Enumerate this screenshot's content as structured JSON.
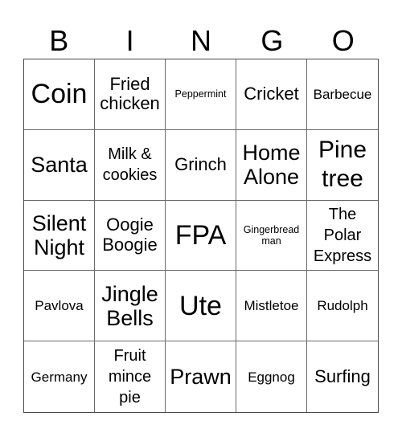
{
  "header": {
    "letters": [
      "B",
      "I",
      "N",
      "G",
      "O"
    ]
  },
  "cells": [
    "Coin",
    "Fried chicken",
    "Peppermint",
    "Cricket",
    "Barbecue",
    "Santa",
    "Milk & cookies",
    "Grinch",
    "Home Alone",
    "Pine tree",
    "Silent Night",
    "Oogie Boogie",
    "FPA",
    "Gingerbread man",
    "The Polar Express",
    "Pavlova",
    "Jingle Bells",
    "Ute",
    "Mistletoe",
    "Rudolph",
    "Germany",
    "Fruit mince pie",
    "Prawn",
    "Eggnog",
    "Surfing"
  ]
}
